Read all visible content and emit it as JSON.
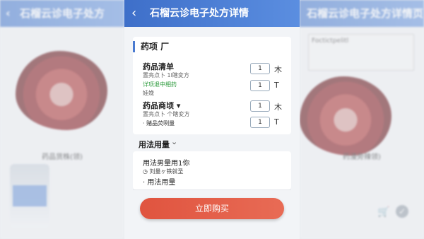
{
  "header": {
    "title": "石榴云诊电子处方详情",
    "back_glyph": "‹"
  },
  "background": {
    "left_title": "石榴云诊电子处方",
    "left_caption": "药品货株(领)",
    "right_title": "石榴云诊电子处方详情页",
    "right_caption": "药漫旁辣领)",
    "rx_text": "Foctictpelitl"
  },
  "section": {
    "title": "药项 厂"
  },
  "drugs": [
    {
      "name": "药品清单",
      "sub": "置亮点卜 1l瞎変方",
      "qty": "1",
      "icon": "木"
    },
    {
      "name": "",
      "sub": "详项退中相药",
      "sub2": "娃娩",
      "qty": "1",
      "icon": "T"
    },
    {
      "name": "药品商顷 ▾",
      "sub": "置亮点卜 个瞎変方",
      "qty": "1",
      "icon": "木"
    },
    {
      "name": "",
      "sub": "· 赌品荧咧量",
      "qty": "1",
      "icon": "T"
    }
  ],
  "usage": {
    "title": "用法用量",
    "chevron": "⌄",
    "line1": "用法男量用1你",
    "line2": "◷ 刘量ヶ铁就圣",
    "line3": "· 用法用量"
  },
  "buy_button": "立即购买",
  "colors": {
    "header": "#3e6fc9",
    "button": "#e0543f",
    "accent": "#4a7ad0"
  }
}
